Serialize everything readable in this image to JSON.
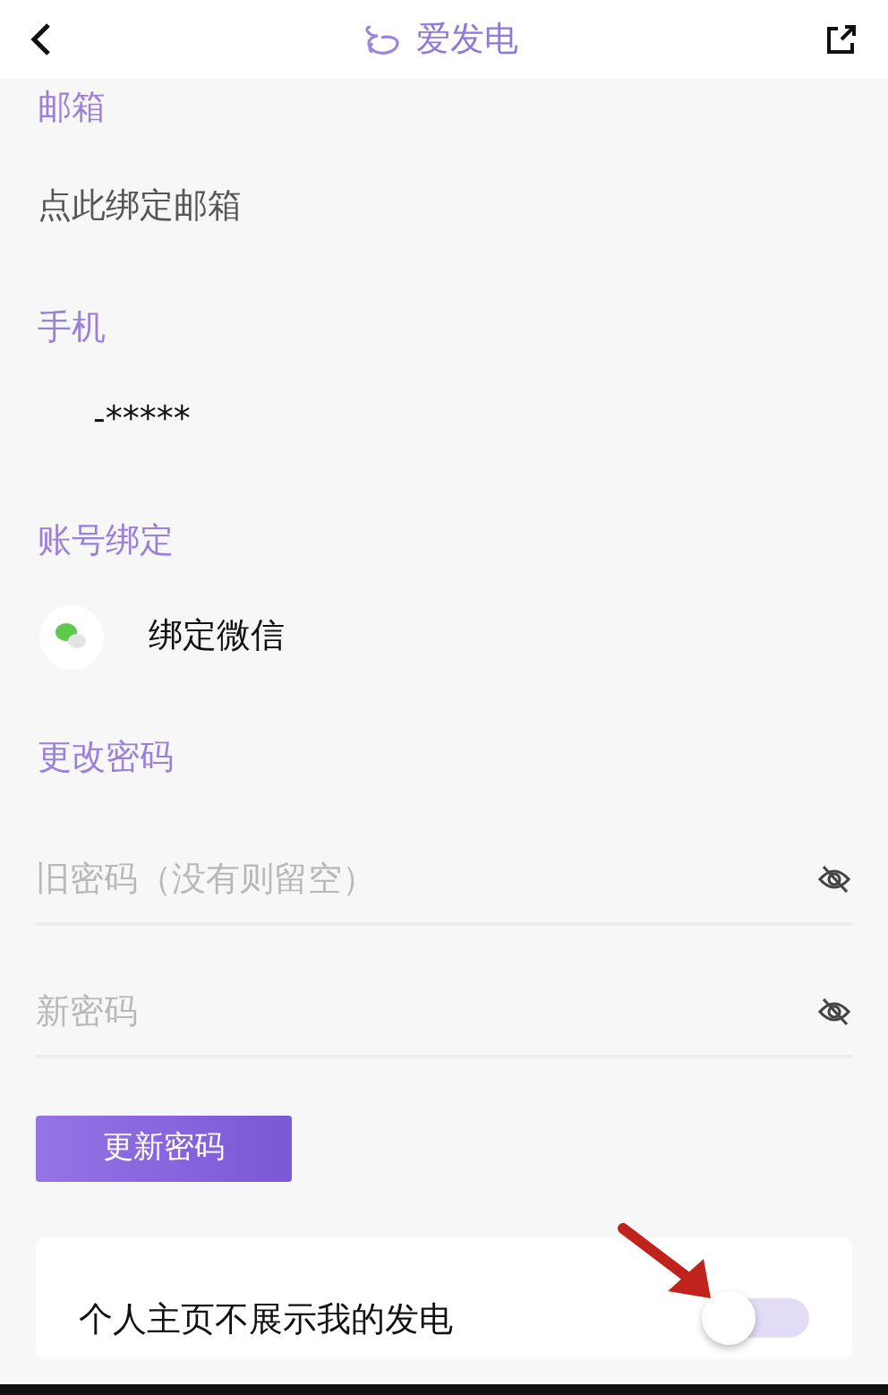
{
  "header": {
    "title": "爱发电"
  },
  "email": {
    "label": "邮箱",
    "value": "点此绑定邮箱"
  },
  "phone": {
    "label": "手机",
    "value": "-*****"
  },
  "binding": {
    "label": "账号绑定",
    "items": [
      {
        "text": "绑定微信"
      }
    ]
  },
  "password": {
    "label": "更改密码",
    "fields": [
      {
        "placeholder": "旧密码（没有则留空）"
      },
      {
        "placeholder": "新密码"
      }
    ],
    "button": "更新密码"
  },
  "privacy": {
    "label": "个人主页不展示我的发电",
    "on": false
  }
}
